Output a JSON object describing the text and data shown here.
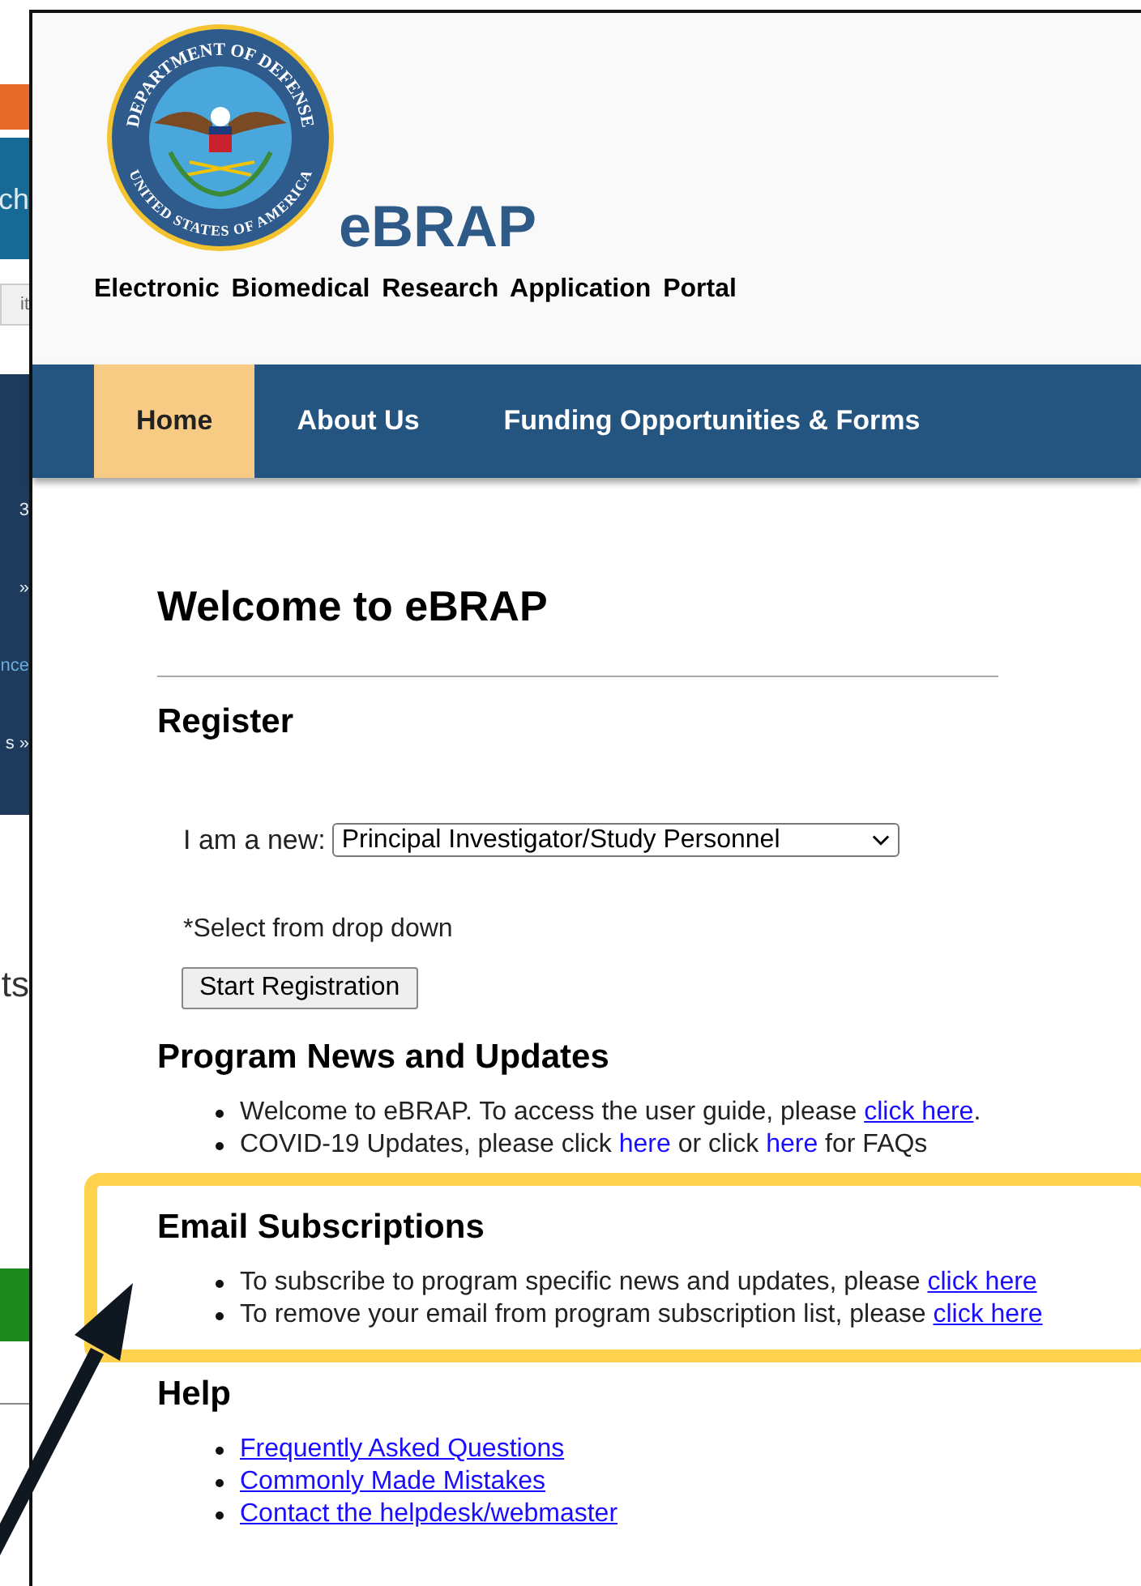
{
  "background_window": {
    "blocks": [
      {
        "kind": "accent"
      },
      {
        "kind": "banner",
        "text": "ch"
      },
      {
        "kind": "field",
        "text": "it"
      },
      {
        "kind": "menu",
        "lines": [
          "3",
          "»",
          "nce",
          "s »"
        ]
      },
      {
        "kind": "blank",
        "text": "ts"
      },
      {
        "kind": "action"
      }
    ]
  },
  "header": {
    "seal_top": "DEPARTMENT OF DEFENSE",
    "seal_bottom": "UNITED STATES OF AMERICA",
    "title": "eBRAP",
    "subtitle": "Electronic Biomedical Research Application Portal"
  },
  "nav": [
    {
      "label": "Home",
      "selected": true
    },
    {
      "label": "About Us",
      "selected": false
    },
    {
      "label": "Funding Opportunities & Forms",
      "selected": false
    }
  ],
  "welcome": "Welcome to eBRAP",
  "register": {
    "heading": "Register",
    "label": "I am a new:",
    "select_value": "Principal Investigator/Study Personnel",
    "note": "*Select from drop down",
    "button": "Start Registration"
  },
  "sections": [
    {
      "heading": "Program News and Updates",
      "highlighted": false,
      "items": [
        [
          {
            "kind": "text",
            "text": "Welcome to eBRAP. To access the user guide, please "
          },
          {
            "kind": "link",
            "text": "click here"
          },
          {
            "kind": "text",
            "text": "."
          }
        ],
        [
          {
            "kind": "text",
            "text": "COVID-19 Updates, please click "
          },
          {
            "kind": "plainlink",
            "text": "here"
          },
          {
            "kind": "text",
            "text": " or click "
          },
          {
            "kind": "plainlink",
            "text": "here"
          },
          {
            "kind": "text",
            "text": " for FAQs"
          }
        ]
      ]
    },
    {
      "heading": "Email Subscriptions",
      "highlighted": true,
      "items": [
        [
          {
            "kind": "text",
            "text": "To subscribe to program specific news and updates, please "
          },
          {
            "kind": "link",
            "text": "click here"
          }
        ],
        [
          {
            "kind": "text",
            "text": "To remove your email from program subscription list, please "
          },
          {
            "kind": "link",
            "text": "click here"
          }
        ]
      ]
    },
    {
      "heading": "Help",
      "highlighted": false,
      "items": [
        [
          {
            "kind": "link",
            "text": "Frequently Asked Questions"
          }
        ],
        [
          {
            "kind": "link",
            "text": "Commonly Made Mistakes"
          }
        ],
        [
          {
            "kind": "link",
            "text": "Contact the helpdesk/webmaster"
          }
        ]
      ]
    }
  ]
}
